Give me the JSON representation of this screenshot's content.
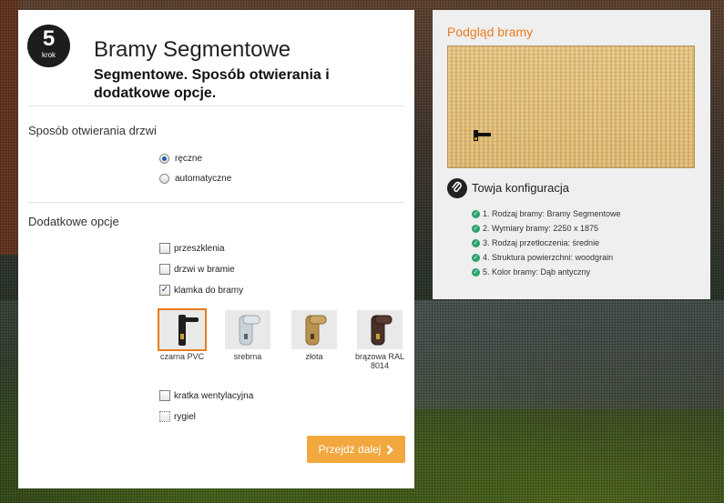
{
  "step": {
    "number": "5",
    "word": "krok"
  },
  "header": {
    "title": "Bramy Segmentowe",
    "subtitle": "Segmentowe. Sposób otwierania i dodatkowe opcje."
  },
  "opening": {
    "label": "Sposób otwierania drzwi",
    "options": [
      {
        "label": "ręczne",
        "checked": true
      },
      {
        "label": "automatyczne",
        "checked": false
      }
    ]
  },
  "extras": {
    "label": "Dodatkowe opcje",
    "options": [
      {
        "label": "przeszklenia",
        "checked": false
      },
      {
        "label": "drzwi w bramie",
        "checked": false
      },
      {
        "label": "klamka do bramy",
        "checked": true
      },
      {
        "label": "kratka wentylacyjna",
        "checked": false
      },
      {
        "label": "rygiel",
        "checked": false
      }
    ],
    "handles": [
      {
        "label": "czarna PVC",
        "color": "#1e1e1e",
        "selected": true
      },
      {
        "label": "srebrna",
        "color": "#c9d2d8",
        "selected": false
      },
      {
        "label": "złota",
        "color": "#b8924e",
        "selected": false
      },
      {
        "label": "brązowa RAL 8014",
        "color": "#4a3128",
        "selected": false
      }
    ]
  },
  "next_button": {
    "label": "Przejdź dalej",
    "icon": "chevron-right-icon"
  },
  "preview": {
    "title": "Podgląd bramy",
    "config_title": "Towja konfiguracja",
    "config_icon": "paperclip-icon",
    "config_items": [
      "1. Rodzaj bramy: Bramy Segmentowe",
      "2. Wymiary bramy: 2250 x 1875",
      "3. Rodzaj przetłoczenia: średnie",
      "4. Struktura powierzchni: woodgrain",
      "5. Kolor bramy: Dąb antyczny"
    ]
  },
  "colors": {
    "accent": "#e87d1e",
    "button": "#f2a83e",
    "check": "#2aa26e"
  }
}
